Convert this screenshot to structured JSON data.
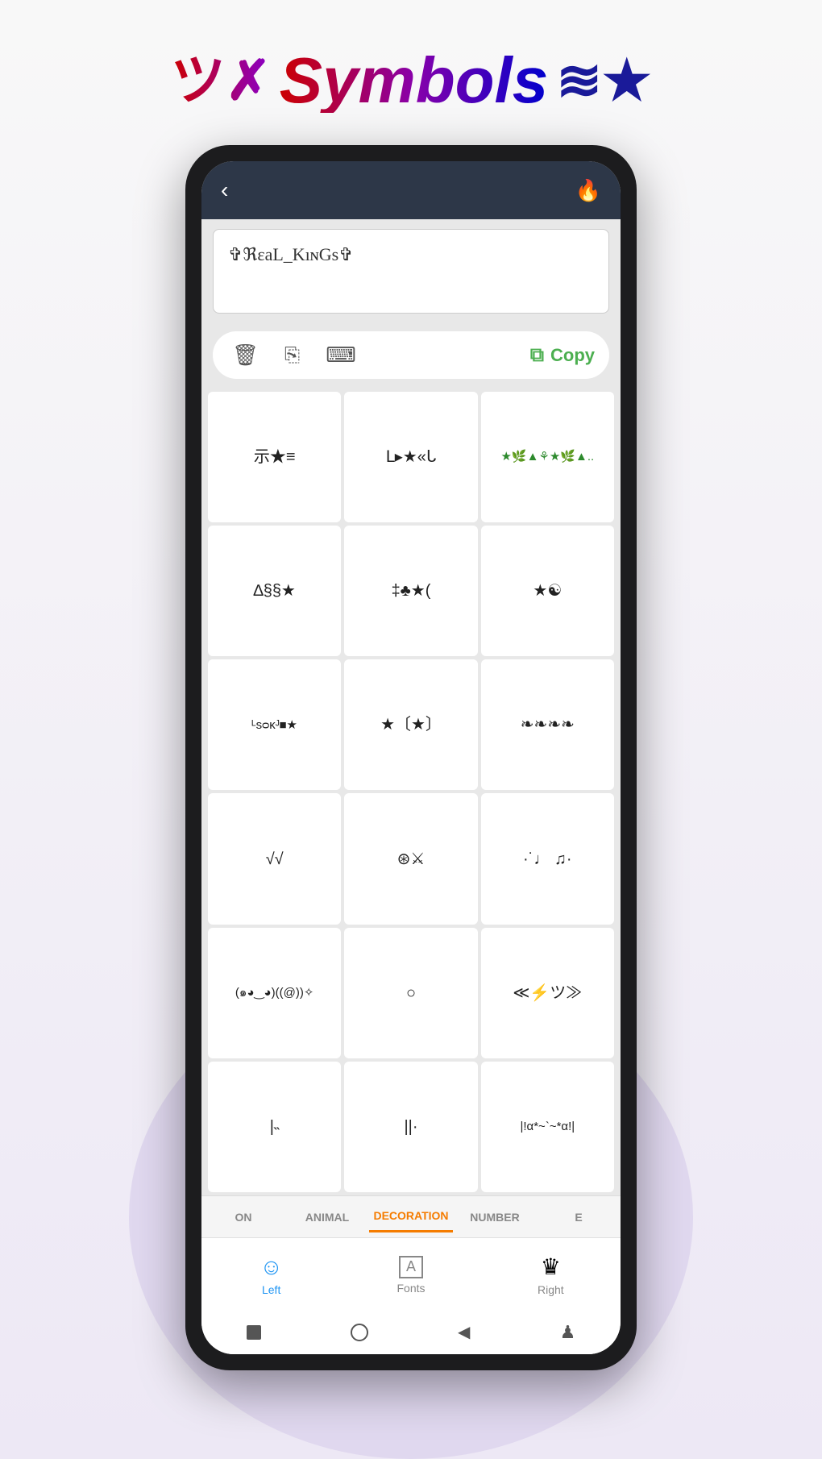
{
  "app": {
    "title_kanji": "ツ✗",
    "title_main": "Symbols",
    "title_right": "≋★"
  },
  "topbar": {
    "back_label": "‹",
    "fire_label": "🔥"
  },
  "textbox": {
    "value": "✞ℜɛaL_KıɴGs✞"
  },
  "actions": {
    "delete_label": "🗑",
    "share_label": "⎘",
    "keyboard_label": "⌨",
    "copy_icon": "⧉",
    "copy_label": "Copy"
  },
  "symbols": [
    {
      "text": "示★≡",
      "style": ""
    },
    {
      "text": "ᒪ▸★«ᒐ",
      "style": ""
    },
    {
      "text": "★🌿▲⚘★🌿▲..",
      "style": "green small"
    },
    {
      "text": "∆§§★",
      "style": ""
    },
    {
      "text": "‡♣★(",
      "style": ""
    },
    {
      "text": "★☯",
      "style": ""
    },
    {
      "text": "ᴸsᴑᴋᴶ■★",
      "style": "small"
    },
    {
      "text": "★〔★〕",
      "style": ""
    },
    {
      "text": "❧❧❧❧",
      "style": ""
    },
    {
      "text": "√√",
      "style": ""
    },
    {
      "text": "⊛⚔",
      "style": ""
    },
    {
      "text": "·˙♩ ♫·",
      "style": ""
    },
    {
      "text": "(๑◕‿◕)((@))✧",
      "style": "small"
    },
    {
      "text": "○",
      "style": ""
    },
    {
      "text": "≪⚡ツ≫",
      "style": ""
    },
    {
      "text": "|˵",
      "style": ""
    },
    {
      "text": "||·",
      "style": ""
    },
    {
      "text": "|!α*~`~*α!|",
      "style": "small"
    }
  ],
  "tabs": [
    {
      "label": "ON",
      "active": false
    },
    {
      "label": "ANIMAL",
      "active": false
    },
    {
      "label": "DECORATION",
      "active": true
    },
    {
      "label": "NUMBER",
      "active": false
    },
    {
      "label": "E",
      "active": false
    }
  ],
  "bottom_nav": [
    {
      "icon": "☺",
      "label": "Left",
      "active": true
    },
    {
      "icon": "A",
      "label": "Fonts",
      "active": false
    },
    {
      "icon": "♛",
      "label": "Right",
      "active": false
    }
  ],
  "android_nav": {
    "square_label": "■",
    "home_label": "○",
    "back_label": "◀",
    "person_label": "♟"
  }
}
